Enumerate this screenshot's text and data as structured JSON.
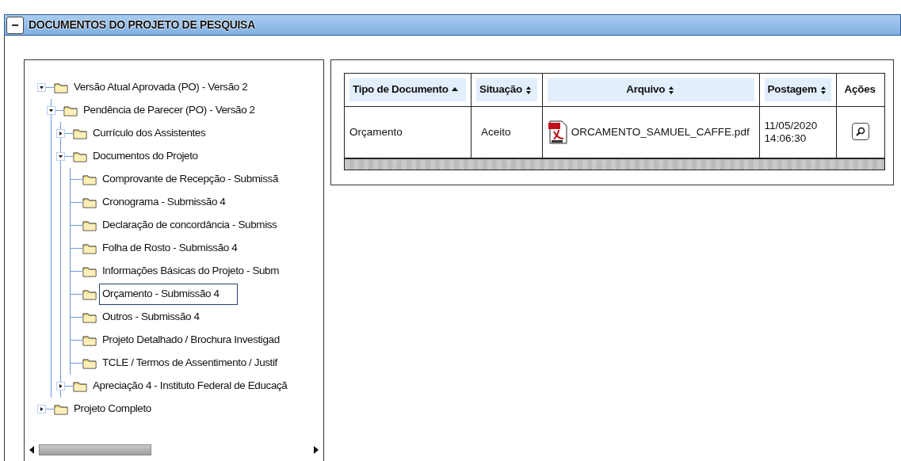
{
  "panel": {
    "collapse_symbol": "−",
    "title": "DOCUMENTOS DO PROJETO DE PESQUISA"
  },
  "tree": [
    {
      "label": "Versão Atual Aprovada (PO) - Versão 2",
      "expanded": true,
      "selected": false,
      "children": [
        {
          "label": "Pendência de Parecer (PO) - Versão 2",
          "expanded": true,
          "selected": false,
          "children": [
            {
              "label": "Currículo dos Assistentes",
              "expanded": false,
              "selected": false
            },
            {
              "label": "Documentos do Projeto",
              "expanded": true,
              "selected": false,
              "children": [
                {
                  "label": "Comprovante de Recepção - Submissã",
                  "selected": false
                },
                {
                  "label": "Cronograma - Submissão 4",
                  "selected": false
                },
                {
                  "label": "Declaração de concordância - Submiss",
                  "selected": false
                },
                {
                  "label": "Folha de Rosto - Submissão 4",
                  "selected": false
                },
                {
                  "label": "Informações Básicas do Projeto - Subm",
                  "selected": false
                },
                {
                  "label": "Orçamento - Submissão 4",
                  "selected": true
                },
                {
                  "label": "Outros - Submissão 4",
                  "selected": false
                },
                {
                  "label": "Projeto Detalhado / Brochura Investigad",
                  "selected": false
                },
                {
                  "label": "TCLE / Termos de Assentimento / Justif",
                  "selected": false
                }
              ]
            },
            {
              "label": "Apreciação 4 - Instituto Federal de Educaçã",
              "expanded": false,
              "selected": false
            }
          ]
        }
      ]
    },
    {
      "label": "Projeto Completo",
      "expanded": false,
      "selected": false
    }
  ],
  "table": {
    "columns": [
      {
        "label": "Tipo de Documento",
        "sortable": true,
        "sorted": true
      },
      {
        "label": "Situação",
        "sortable": true,
        "sorted": false
      },
      {
        "label": "Arquivo",
        "sortable": true,
        "sorted": false
      },
      {
        "label": "Postagem",
        "sortable": true,
        "sorted": false
      },
      {
        "label": "Ações",
        "sortable": false
      }
    ],
    "rows": [
      {
        "document_type": "Orçamento",
        "status": "Aceito",
        "file": "ORCAMENTO_SAMUEL_CAFFE.pdf",
        "posted": "11/05/2020 14:06:30"
      }
    ]
  }
}
